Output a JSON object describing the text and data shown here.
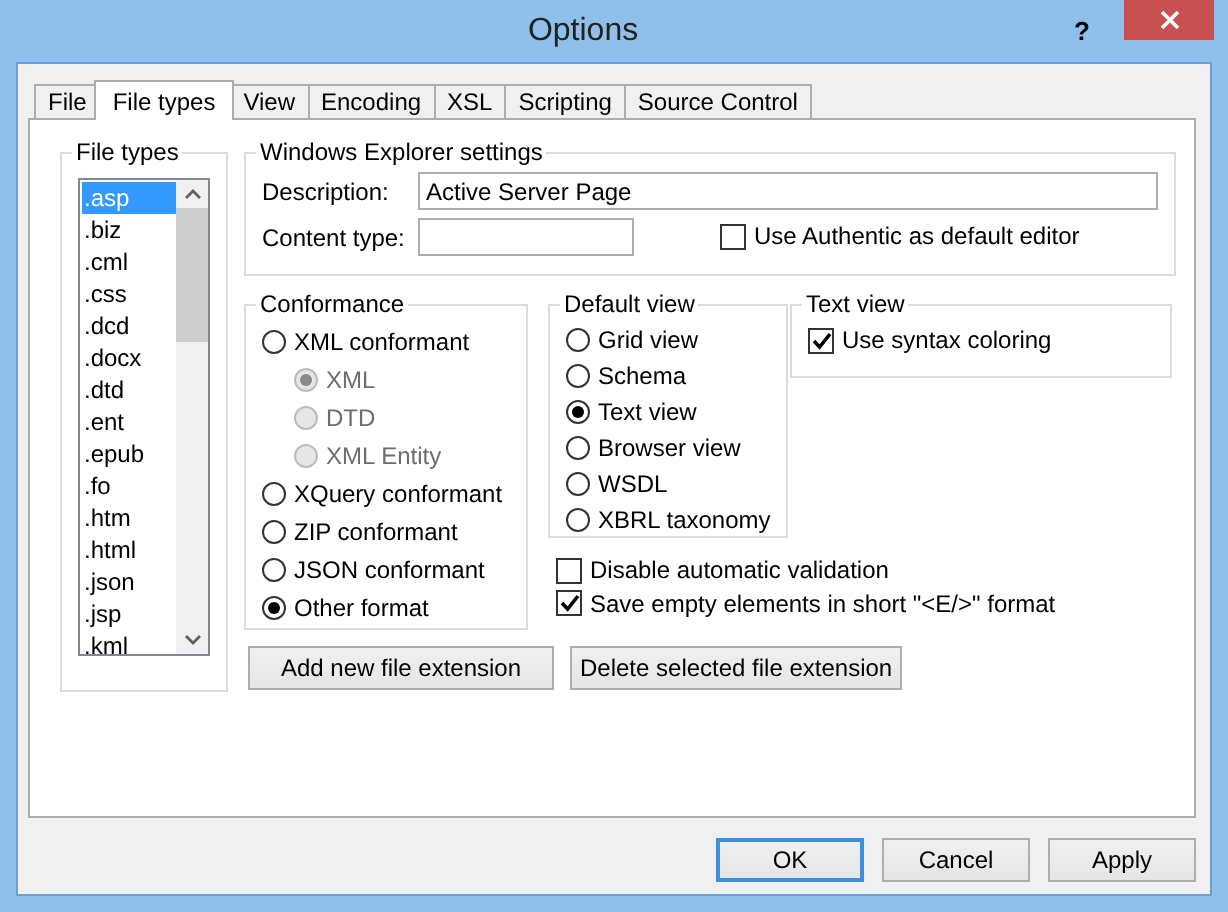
{
  "window": {
    "title": "Options",
    "help": "?"
  },
  "tabs": [
    {
      "label": "File",
      "selected": false
    },
    {
      "label": "File types",
      "selected": true
    },
    {
      "label": "View",
      "selected": false
    },
    {
      "label": "Encoding",
      "selected": false
    },
    {
      "label": "XSL",
      "selected": false
    },
    {
      "label": "Scripting",
      "selected": false
    },
    {
      "label": "Source Control",
      "selected": false
    }
  ],
  "file_types": {
    "label": "File types",
    "items": [
      {
        "label": ".asp",
        "selected": true
      },
      {
        "label": ".biz",
        "selected": false
      },
      {
        "label": ".cml",
        "selected": false
      },
      {
        "label": ".css",
        "selected": false
      },
      {
        "label": ".dcd",
        "selected": false
      },
      {
        "label": ".docx",
        "selected": false
      },
      {
        "label": ".dtd",
        "selected": false
      },
      {
        "label": ".ent",
        "selected": false
      },
      {
        "label": ".epub",
        "selected": false
      },
      {
        "label": ".fo",
        "selected": false
      },
      {
        "label": ".htm",
        "selected": false
      },
      {
        "label": ".html",
        "selected": false
      },
      {
        "label": ".json",
        "selected": false
      },
      {
        "label": ".jsp",
        "selected": false
      },
      {
        "label": ".kml",
        "selected": false
      }
    ]
  },
  "explorer_settings": {
    "label": "Windows Explorer settings",
    "description": {
      "label": "Description:",
      "value": "Active Server Page"
    },
    "content_type": {
      "label": "Content type:"
    },
    "authentic": {
      "label": "Use Authentic as default editor",
      "checked": false
    }
  },
  "conformance": {
    "label": "Conformance",
    "options": [
      {
        "label": "XML conformant",
        "selected": false,
        "disabled": false,
        "children": [
          {
            "label": "XML",
            "selected": true,
            "disabled": true
          },
          {
            "label": "DTD",
            "selected": false,
            "disabled": true
          },
          {
            "label": "XML Entity",
            "selected": false,
            "disabled": true
          }
        ]
      },
      {
        "label": "XQuery conformant",
        "selected": false,
        "disabled": false
      },
      {
        "label": "ZIP conformant",
        "selected": false,
        "disabled": false
      },
      {
        "label": "JSON conformant",
        "selected": false,
        "disabled": false
      },
      {
        "label": "Other format",
        "selected": true,
        "disabled": false
      }
    ]
  },
  "default_view": {
    "label": "Default view",
    "options": [
      {
        "label": "Grid view",
        "selected": false
      },
      {
        "label": "Schema",
        "selected": false
      },
      {
        "label": "Text view",
        "selected": true
      },
      {
        "label": "Browser view",
        "selected": false
      },
      {
        "label": "WSDL",
        "selected": false
      },
      {
        "label": "XBRL taxonomy",
        "selected": false
      }
    ]
  },
  "text_view": {
    "label": "Text view",
    "options": [
      {
        "label": "Use syntax coloring",
        "checked": true
      }
    ]
  },
  "validation": [
    {
      "label": "Disable automatic validation",
      "checked": false
    },
    {
      "label": "Save empty elements in short \"<E/>\" format",
      "checked": true
    }
  ],
  "extension_buttons": [
    {
      "label": "Add new file extension"
    },
    {
      "label": "Delete selected file extension"
    }
  ],
  "dialog_buttons": [
    {
      "label": "OK",
      "default": true
    },
    {
      "label": "Cancel",
      "default": false
    },
    {
      "label": "Apply",
      "default": false
    }
  ]
}
